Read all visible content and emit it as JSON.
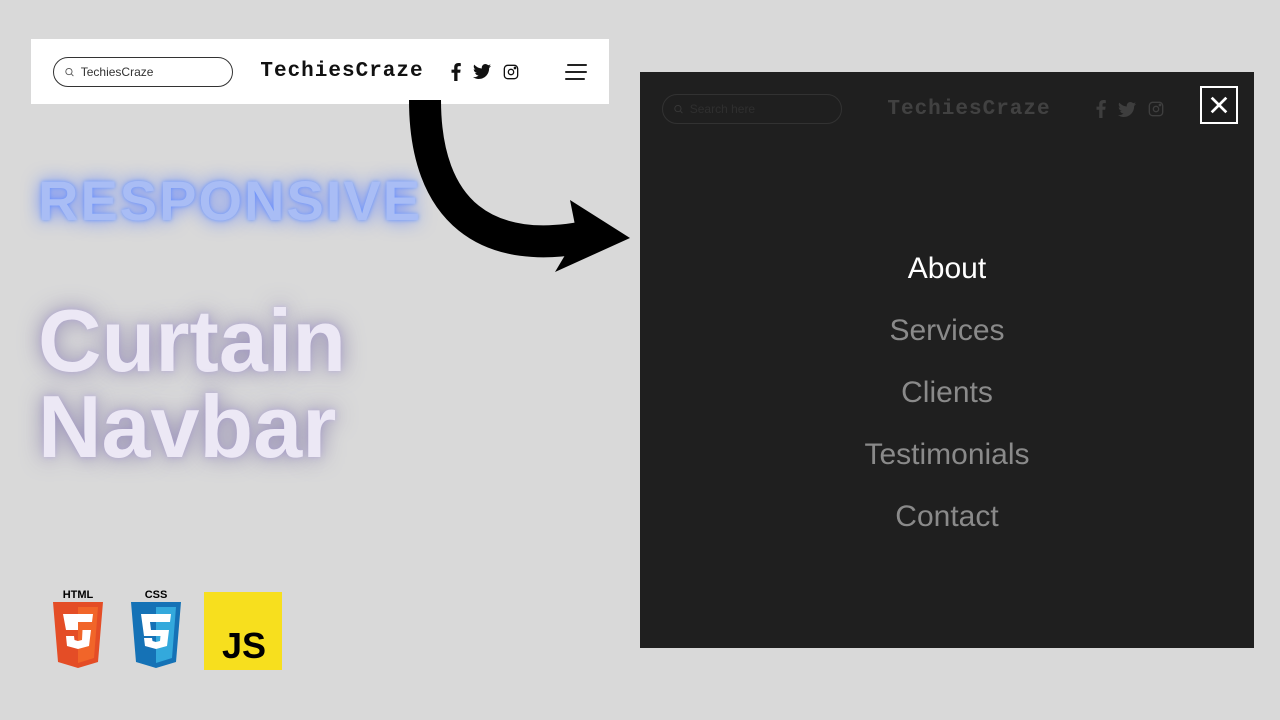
{
  "navbar": {
    "search_value": "TechiesCraze",
    "brand": "TechiesCraze"
  },
  "headline": {
    "line1": "RESPONSIVE",
    "line2a": "Curtain",
    "line2b": "Navbar"
  },
  "badges": {
    "html": "HTML",
    "css": "CSS",
    "js": "JS"
  },
  "curtain": {
    "search_placeholder": "Search here",
    "brand": "TechiesCraze",
    "menu": [
      "About",
      "Services",
      "Clients",
      "Testimonials",
      "Contact"
    ]
  }
}
